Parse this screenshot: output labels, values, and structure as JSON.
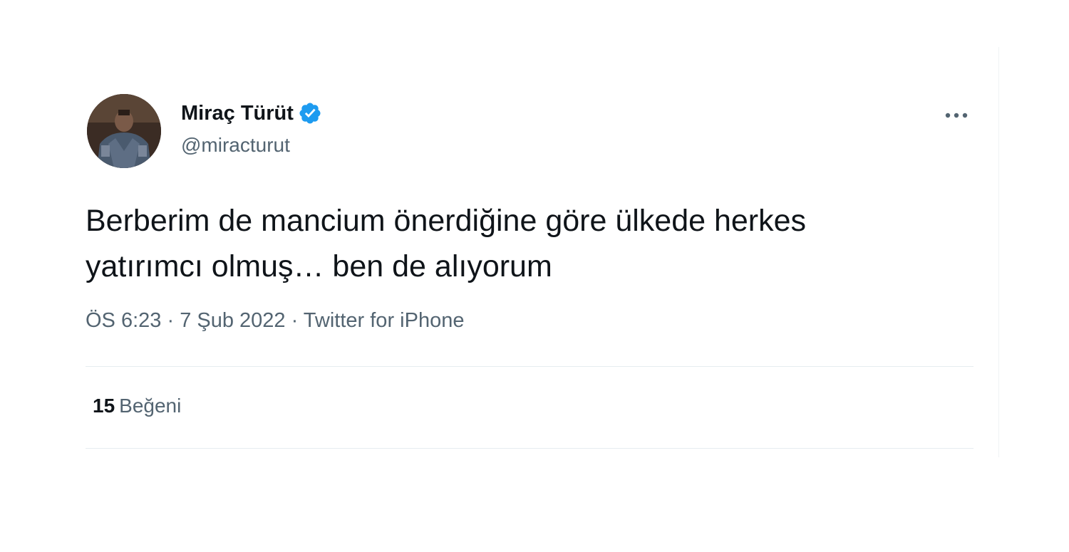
{
  "author": {
    "name": "Miraç Türüt",
    "handle": "@miracturut",
    "verified": true
  },
  "tweet": {
    "text_line1": "Berberim de mancium önerdiğine göre ülkede herkes",
    "text_line2": "yatırımcı olmuş… ben de alıyorum",
    "time": "ÖS 6:23",
    "separator": " · ",
    "date": "7 Şub 2022",
    "source": "Twitter for iPhone"
  },
  "stats": {
    "likes_count": "15",
    "likes_label": "Beğeni"
  },
  "icons": {
    "verified": "verified-badge-icon",
    "more": "more-horizontal-icon"
  },
  "colors": {
    "verified_blue": "#1d9bf0",
    "text_primary": "#0f1419",
    "text_secondary": "#536471",
    "divider": "#eff3f4"
  }
}
